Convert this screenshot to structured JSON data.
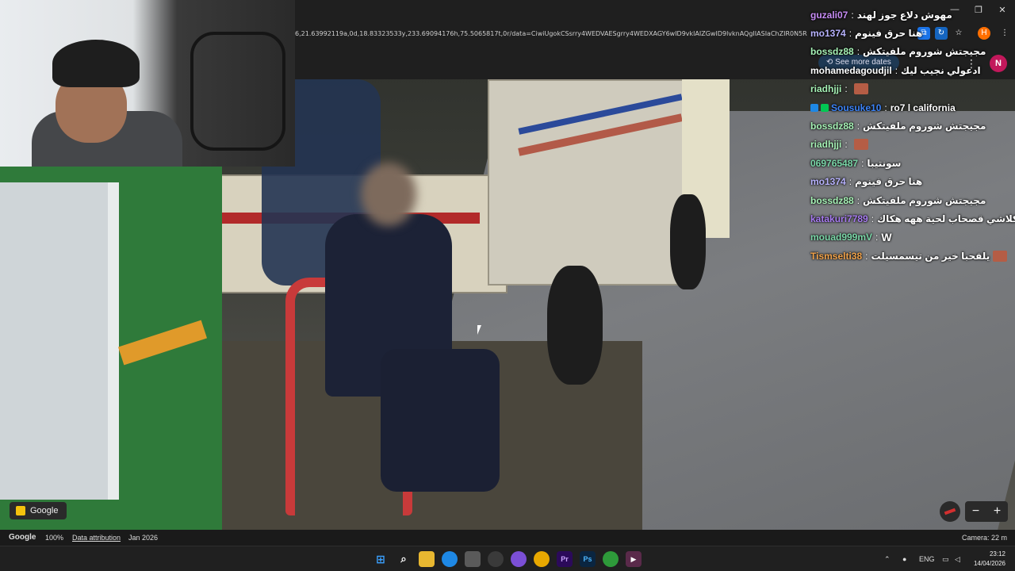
{
  "browser": {
    "address": "6,21.63992119a,0d,18.83323533y,233.69094176h,75.5065817t,0r/data=CiwiUgokCSsrry4WEDVAESgrry4WEDXAGY6wID9vklAIZGwID9lvknAQgIIASIaChZIR0N5R",
    "see_more_dates": "See more dates",
    "profile_initial": "N",
    "icons": [
      "extension-icon",
      "sync-icon",
      "translate-icon",
      "star-icon",
      "honey-icon",
      "menu-icon"
    ],
    "window_controls": [
      "minimize",
      "restore",
      "close"
    ]
  },
  "chat": [
    {
      "user": "guzali07",
      "color": "#c78cf5",
      "msg": "مهوش دلاع جوز لهند",
      "emote": false
    },
    {
      "user": "mo1374",
      "color": "#b8b3ff",
      "msg": "هنا حرق فينوم",
      "emote": false
    },
    {
      "user": "bossdz88",
      "color": "#a6f2b6",
      "msg": "مجيجتش شوروم ملفيتكش",
      "emote": false
    },
    {
      "user": "mohamedagoudjil",
      "color": "#ffffff",
      "msg": "ادعولي نجيب ليك",
      "emote": false
    },
    {
      "user": "riadhjji",
      "color": "#a6f2b6",
      "msg": "",
      "emote": true
    },
    {
      "user": "Sousuke10",
      "color": "#3b82f6",
      "msg": "ro7 l california",
      "emote": false,
      "badges": true
    },
    {
      "user": "bossdz88",
      "color": "#a6f2b6",
      "msg": "مجيجتش شوروم ملفيتكش",
      "emote": false
    },
    {
      "user": "riadhjji",
      "color": "#a6f2b6",
      "msg": "",
      "emote": true
    },
    {
      "user": "069765487",
      "color": "#7ad7a8",
      "msg": "سونتيبا",
      "emote": false
    },
    {
      "user": "mo1374",
      "color": "#b8b3ff",
      "msg": "هنا حرق فينوم",
      "emote": false
    },
    {
      "user": "bossdz88",
      "color": "#a6f2b6",
      "msg": "مجيجتش شوروم ملفيتكش",
      "emote": false
    },
    {
      "user": "katakuri7789",
      "color": "#a77bf0",
      "msg": "راك تكلاشي قصحاب لحية ههه هكاك",
      "emote": false
    },
    {
      "user": "mouad999mV",
      "color": "#7ad7a8",
      "msg": "W",
      "emote": false,
      "emote_w": true
    },
    {
      "user": "Tismselti38",
      "color": "#f0a24a",
      "msg": "يلقحبا خير من تيسمسيلت",
      "emote": true
    }
  ],
  "map": {
    "google_chip": "Google",
    "zoom_out": "−",
    "zoom_in": "+"
  },
  "status_bar": {
    "google": "Google",
    "zoom": "100%",
    "attribution": "Data attribution",
    "date": "Jan 2026",
    "camera": "Camera: 22 m"
  },
  "taskbar": {
    "language": "ENG",
    "time": "23:12",
    "date": "14/04/2026"
  }
}
